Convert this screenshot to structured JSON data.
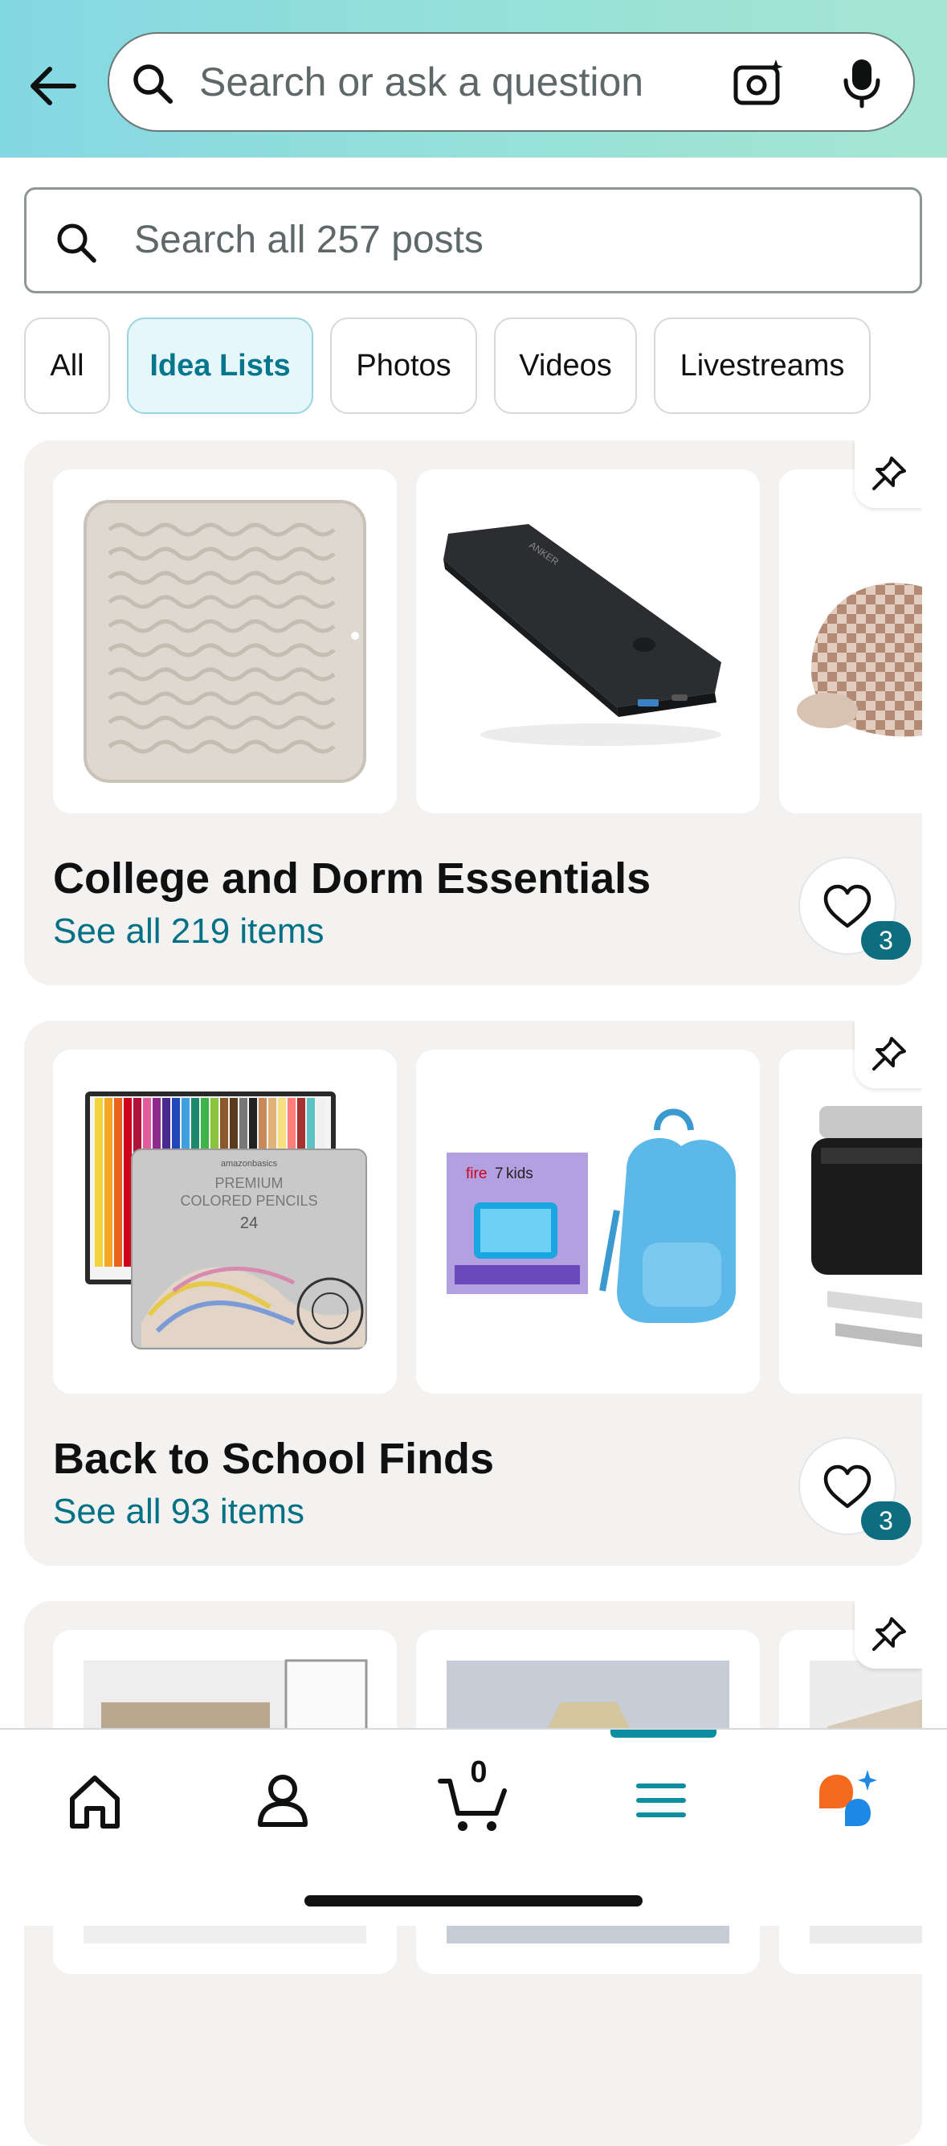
{
  "header": {
    "search_placeholder": "Search or ask a question"
  },
  "posts_search": {
    "placeholder": "Search all 257 posts"
  },
  "filters": [
    {
      "label": "All",
      "active": false
    },
    {
      "label": "Idea Lists",
      "active": true
    },
    {
      "label": "Photos",
      "active": false
    },
    {
      "label": "Videos",
      "active": false
    },
    {
      "label": "Livestreams",
      "active": false
    }
  ],
  "idea_lists": [
    {
      "title": "College and Dorm Essentials",
      "link": "See all 219 items",
      "likes": "3",
      "thumbnails": [
        "dish-drying-mat",
        "portable-power-bank",
        "slippers"
      ]
    },
    {
      "title": "Back to School Finds",
      "link": "See all 93 items",
      "likes": "3",
      "thumbnails": [
        "colored-pencils",
        "kids-tablet-backpack",
        "lunch-cooler"
      ],
      "pencils": {
        "brand": "amazonbasics",
        "line1": "PREMIUM",
        "line2": "COLORED PENCILS",
        "count": "24"
      },
      "tablet": {
        "brand": "fire",
        "model": "7",
        "edition": "kids"
      }
    },
    {
      "title": "",
      "link": "",
      "thumbnails": [
        "bedroom",
        "lamp",
        "room"
      ]
    }
  ],
  "bottom_nav": {
    "items": [
      "home-icon",
      "account-icon",
      "cart-icon",
      "menu-icon",
      "ai-assistant-icon"
    ],
    "cart_count": "0",
    "active_item": "menu-icon"
  },
  "colors": {
    "accent": "#007185",
    "badge": "#0e6e80",
    "header_gradient_start": "#84d8e3",
    "header_gradient_end": "#a5e6d2"
  }
}
